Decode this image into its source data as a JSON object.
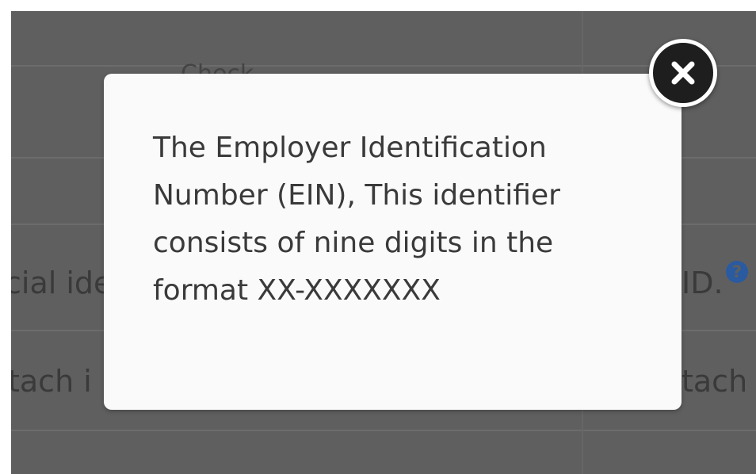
{
  "background": {
    "header_text": "Check",
    "row1_left_text": "cial ide",
    "row1_right_text": "ID.",
    "row2_left_text": "tach i",
    "row2_right_text": "tach",
    "help_icon": "question-circle-icon"
  },
  "modal": {
    "message": "The Employer Identification\nNumber (EIN), This identifier\nconsists of nine digits in the\nformat XX-XXXXXXX",
    "close_icon": "close-icon"
  },
  "colors": {
    "overlay": "#5f5f5f",
    "modal_bg": "#fafafa",
    "close_button": "#1e1e1e",
    "help_icon": "#2a5aa0",
    "dark_button": "#143d57"
  }
}
